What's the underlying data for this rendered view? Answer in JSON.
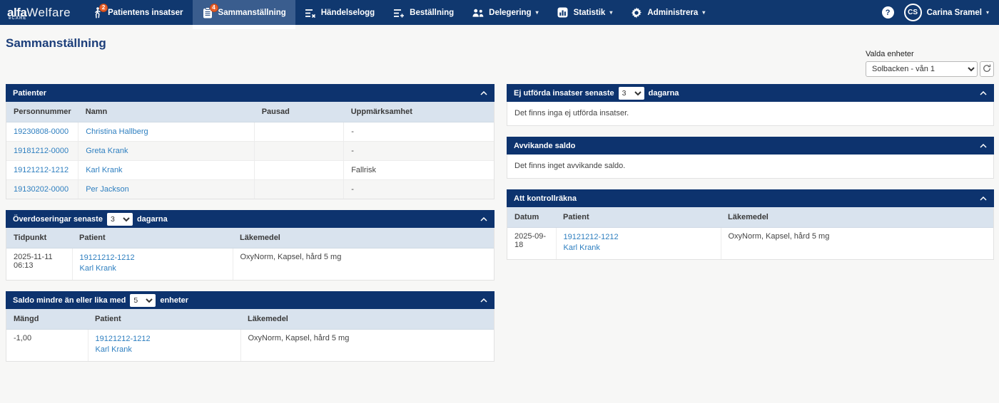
{
  "brand": {
    "name_bold": "alfa",
    "name_light": "Welfare",
    "sub": "eCARE"
  },
  "colors": {
    "navbar": "#10386f",
    "panel_header": "#0d336e",
    "active_tab": "#3a5d8e",
    "badge": "#e8612c",
    "table_header_bg": "#d9e3ee",
    "link": "#2e7fc0"
  },
  "nav": {
    "items": [
      {
        "label": "Patientens insatser",
        "icon": "walking-person-icon",
        "badge": "2"
      },
      {
        "label": "Sammanställning",
        "icon": "clipboard-icon",
        "badge": "4",
        "active": true
      },
      {
        "label": "Händelselogg",
        "icon": "event-log-icon"
      },
      {
        "label": "Beställning",
        "icon": "order-list-icon"
      },
      {
        "label": "Delegering",
        "icon": "people-icon",
        "caret": "▾"
      },
      {
        "label": "Statistik",
        "icon": "bar-chart-icon",
        "caret": "▾"
      },
      {
        "label": "Administrera",
        "icon": "gear-icon",
        "caret": "▾"
      }
    ],
    "help_label": "?",
    "user": {
      "initials": "CS",
      "name": "Carina Sramel",
      "caret": "▾"
    }
  },
  "page": {
    "title": "Sammanställning"
  },
  "unit_filter": {
    "label": "Valda enheter",
    "selected": "Solbacken - vån 1"
  },
  "panels": {
    "patients": {
      "title": "Patienter",
      "columns": [
        "Personnummer",
        "Namn",
        "Pausad",
        "Uppmärksamhet"
      ],
      "rows": [
        {
          "pnr": "19230808-0000",
          "name": "Christina Hallberg",
          "paused": "",
          "attention": "-"
        },
        {
          "pnr": "19181212-0000",
          "name": "Greta Krank",
          "paused": "",
          "attention": "-"
        },
        {
          "pnr": "19121212-1212",
          "name": "Karl Krank",
          "paused": "",
          "attention": "Fallrisk"
        },
        {
          "pnr": "19130202-0000",
          "name": "Per Jackson",
          "paused": "",
          "attention": "-"
        }
      ]
    },
    "overdoses": {
      "title_before": "Överdoseringar senaste",
      "select_value": "3",
      "title_after": "dagarna",
      "columns": [
        "Tidpunkt",
        "Patient",
        "Läkemedel"
      ],
      "rows": [
        {
          "time": "2025-11-11 06:13",
          "pnr": "19121212-1212",
          "name": "Karl Krank",
          "med": "OxyNorm, Kapsel, hård 5 mg"
        }
      ]
    },
    "low_balance": {
      "title_before": "Saldo mindre än eller lika med",
      "select_value": "5",
      "title_after": "enheter",
      "columns": [
        "Mängd",
        "Patient",
        "Läkemedel"
      ],
      "rows": [
        {
          "amount": "-1,00",
          "pnr": "19121212-1212",
          "name": "Karl Krank",
          "med": "OxyNorm, Kapsel, hård 5 mg"
        }
      ]
    },
    "not_performed": {
      "title_before": "Ej utförda insatser senaste",
      "select_value": "3",
      "title_after": "dagarna",
      "empty_text": "Det finns inga ej utförda insatser."
    },
    "deviant_balance": {
      "title": "Avvikande saldo",
      "empty_text": "Det finns inget avvikande saldo."
    },
    "control_count": {
      "title": "Att kontrollräkna",
      "columns": [
        "Datum",
        "Patient",
        "Läkemedel"
      ],
      "rows": [
        {
          "date": "2025-09-18",
          "pnr": "19121212-1212",
          "name": "Karl Krank",
          "med": "OxyNorm, Kapsel, hård 5 mg"
        }
      ]
    }
  }
}
